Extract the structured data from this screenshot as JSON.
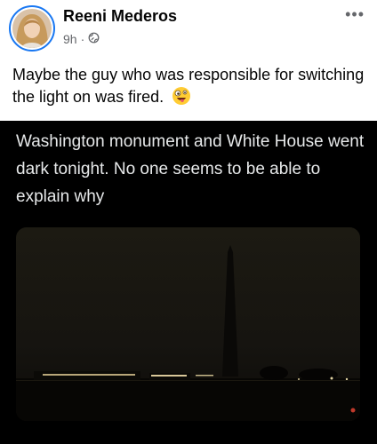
{
  "post": {
    "author": "Reeni Mederos",
    "time": "9h",
    "separator": "·",
    "privacy_icon": "globe-icon",
    "more_icon": "more-options-icon",
    "more_glyph": "•••",
    "text": "Maybe the guy who was responsible for switching the light on was fired.",
    "emoji": "zany-face-emoji"
  },
  "media": {
    "caption": "Washington monument and White House went dark tonight. No one seems to be able to explain why"
  }
}
